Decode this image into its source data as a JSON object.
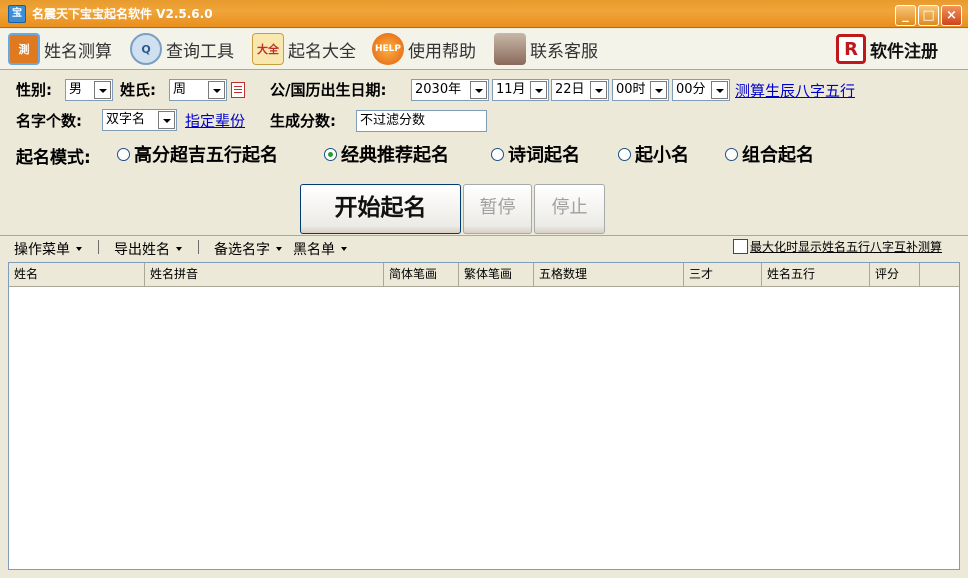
{
  "window": {
    "title": "名震天下宝宝起名软件 V2.5.6.0",
    "app_icon_text": "宝",
    "minimize_glyph": "_",
    "maximize_glyph": "□",
    "close_glyph": "×"
  },
  "toolbar": {
    "items": [
      {
        "label": "姓名测算",
        "icon_text": "測",
        "icon": "name-test-icon"
      },
      {
        "label": "查询工具",
        "icon_text": "Q",
        "icon": "magnifier-icon"
      },
      {
        "label": "起名大全",
        "icon_text": "大全",
        "icon": "book-icon"
      },
      {
        "label": "使用帮助",
        "icon_text": "HELP",
        "icon": "help-icon"
      },
      {
        "label": "联系客服",
        "icon_text": "",
        "icon": "customer-service-icon"
      }
    ],
    "register": {
      "label": "软件注册",
      "icon_text": "R",
      "icon": "register-icon"
    }
  },
  "form": {
    "gender_label": "性别:",
    "gender_value": "男",
    "surname_label": "姓氏:",
    "surname_value": "周",
    "birth_label": "公/国历出生日期:",
    "year_value": "2030年",
    "month_value": "11月",
    "day_value": "22日",
    "hour_value": "00时",
    "minute_value": "00分",
    "bazi_link": "测算生辰八字五行",
    "name_count_label": "名字个数:",
    "name_count_value": "双字名",
    "generation_link": "指定辈份",
    "score_label": "生成分数:",
    "score_value": "不过滤分数",
    "mode_label": "起名模式:",
    "modes": [
      {
        "label": "高分超吉五行起名",
        "checked": false
      },
      {
        "label": "经典推荐起名",
        "checked": true
      },
      {
        "label": "诗词起名",
        "checked": false
      },
      {
        "label": "起小名",
        "checked": false
      },
      {
        "label": "组合起名",
        "checked": false
      }
    ]
  },
  "actions": {
    "start": "开始起名",
    "pause": "暂停",
    "stop": "停止"
  },
  "menu": {
    "operate": "操作菜单",
    "export": "导出姓名",
    "candidates": "备选名字",
    "blacklist": "黑名单",
    "maximize_checkbox": "最大化时显示姓名五行八字互补测算"
  },
  "grid": {
    "columns": [
      "姓名",
      "姓名拼音",
      "简体笔画",
      "繁体笔画",
      "五格数理",
      "三才",
      "姓名五行",
      "评分"
    ]
  }
}
